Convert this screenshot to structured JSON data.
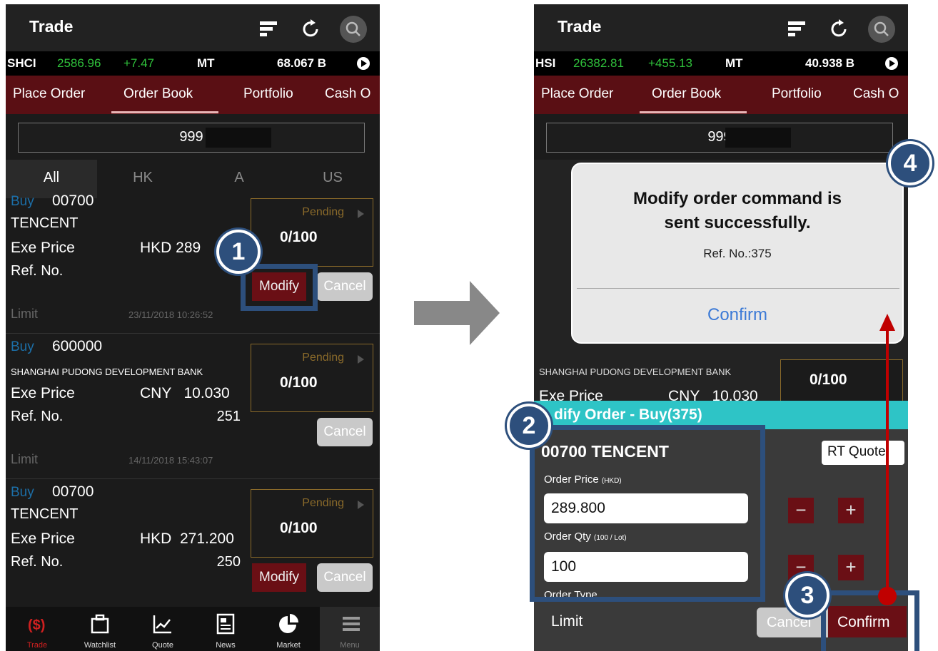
{
  "left": {
    "title": "Trade",
    "ticker": {
      "index": "SHCI",
      "value": "2586.96",
      "change": "+7.47",
      "mt": "MT",
      "amount": "68.067 B"
    },
    "tabs": [
      "Place Order",
      "Order Book",
      "Portfolio",
      "Cash O"
    ],
    "account": "999",
    "market_tabs": [
      "All",
      "HK",
      "A",
      "US"
    ],
    "orders": [
      {
        "side": "Buy",
        "code": "00700",
        "name": "TENCENT",
        "exe_label": "Exe Price",
        "exe_value": "HKD 289",
        "ref_label": "Ref. No.",
        "ref_value": "3",
        "status": "Pending",
        "qty": "0/100",
        "modify": "Modify",
        "cancel": "Cancel",
        "type": "Limit",
        "time": "23/11/2018 10:26:52"
      },
      {
        "side": "Buy",
        "code": "600000",
        "name": "SHANGHAI PUDONG DEVELOPMENT BANK",
        "exe_label": "Exe Price",
        "exe_value": "CNY   10.030",
        "ref_label": "Ref. No.",
        "ref_value": "251",
        "status": "Pending",
        "qty": "0/100",
        "cancel": "Cancel",
        "type": "Limit",
        "time": "14/11/2018 15:43:07"
      },
      {
        "side": "Buy",
        "code": "00700",
        "name": "TENCENT",
        "exe_label": "Exe Price",
        "exe_value": "HKD  271.200",
        "ref_label": "Ref. No.",
        "ref_value": "250",
        "status": "Pending",
        "qty": "0/100",
        "modify": "Modify",
        "cancel": "Cancel"
      }
    ],
    "nav": [
      "Trade",
      "Watchlist",
      "Quote",
      "News",
      "Market",
      "Menu"
    ]
  },
  "right": {
    "title": "Trade",
    "ticker": {
      "index": "HSI",
      "value": "26382.81",
      "change": "+455.13",
      "mt": "MT",
      "amount": "40.938 B"
    },
    "tabs": [
      "Place Order",
      "Order Book",
      "Portfolio",
      "Cash O"
    ],
    "account": "999",
    "alert": {
      "line1": "Modify order command is",
      "line2": "sent successfully.",
      "ref": "Ref. No.:375",
      "confirm": "Confirm"
    },
    "bg_order": {
      "name": "SHANGHAI PUDONG DEVELOPMENT BANK",
      "exe_label": "Exe Price",
      "exe_value": "CNY   10.030",
      "qty": "0/100"
    },
    "modify": {
      "header": "dify Order - Buy(375)",
      "stock": "00700   TENCENT",
      "rt_quote": "RT Quote",
      "price_label": "Order Price",
      "price_unit": "(HKD)",
      "price": "289.800",
      "qty_label": "Order Qty",
      "qty_unit": "(100 / Lot)",
      "qty": "100",
      "type_label": "Order Type",
      "type": "Limit",
      "cancel": "Cancel",
      "confirm": "Confirm"
    }
  },
  "markers": [
    "1",
    "2",
    "3",
    "4"
  ],
  "colors": {
    "annotation": "#2d4f7c",
    "arrow_red": "#c00000",
    "tab_bar": "#5a0f14",
    "modify_bar": "#2ec4c6"
  }
}
